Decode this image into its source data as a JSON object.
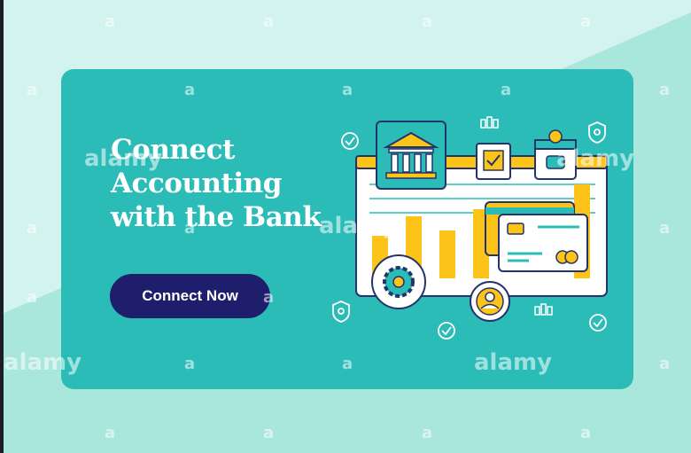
{
  "banner": {
    "headline_line1": "Connect",
    "headline_line2": "Accounting",
    "headline_line3": "with the Bank",
    "cta_label": "Connect Now"
  },
  "colors": {
    "banner_bg": "#2bbcb8",
    "cta_bg": "#1f1e6d",
    "accent_yellow": "#fcc419",
    "outline_navy": "#24336b",
    "page_bg": "#a9e6dc"
  },
  "illustration": {
    "icons": [
      "bank-icon",
      "document-check-icon",
      "wallet-icon",
      "coins-icon",
      "shield-icon",
      "check-circle-icon",
      "gear-icon",
      "user-group-icon",
      "credit-card-icon",
      "bar-chart-icon"
    ]
  },
  "watermark": {
    "brand": "alamy",
    "mark": "a"
  }
}
